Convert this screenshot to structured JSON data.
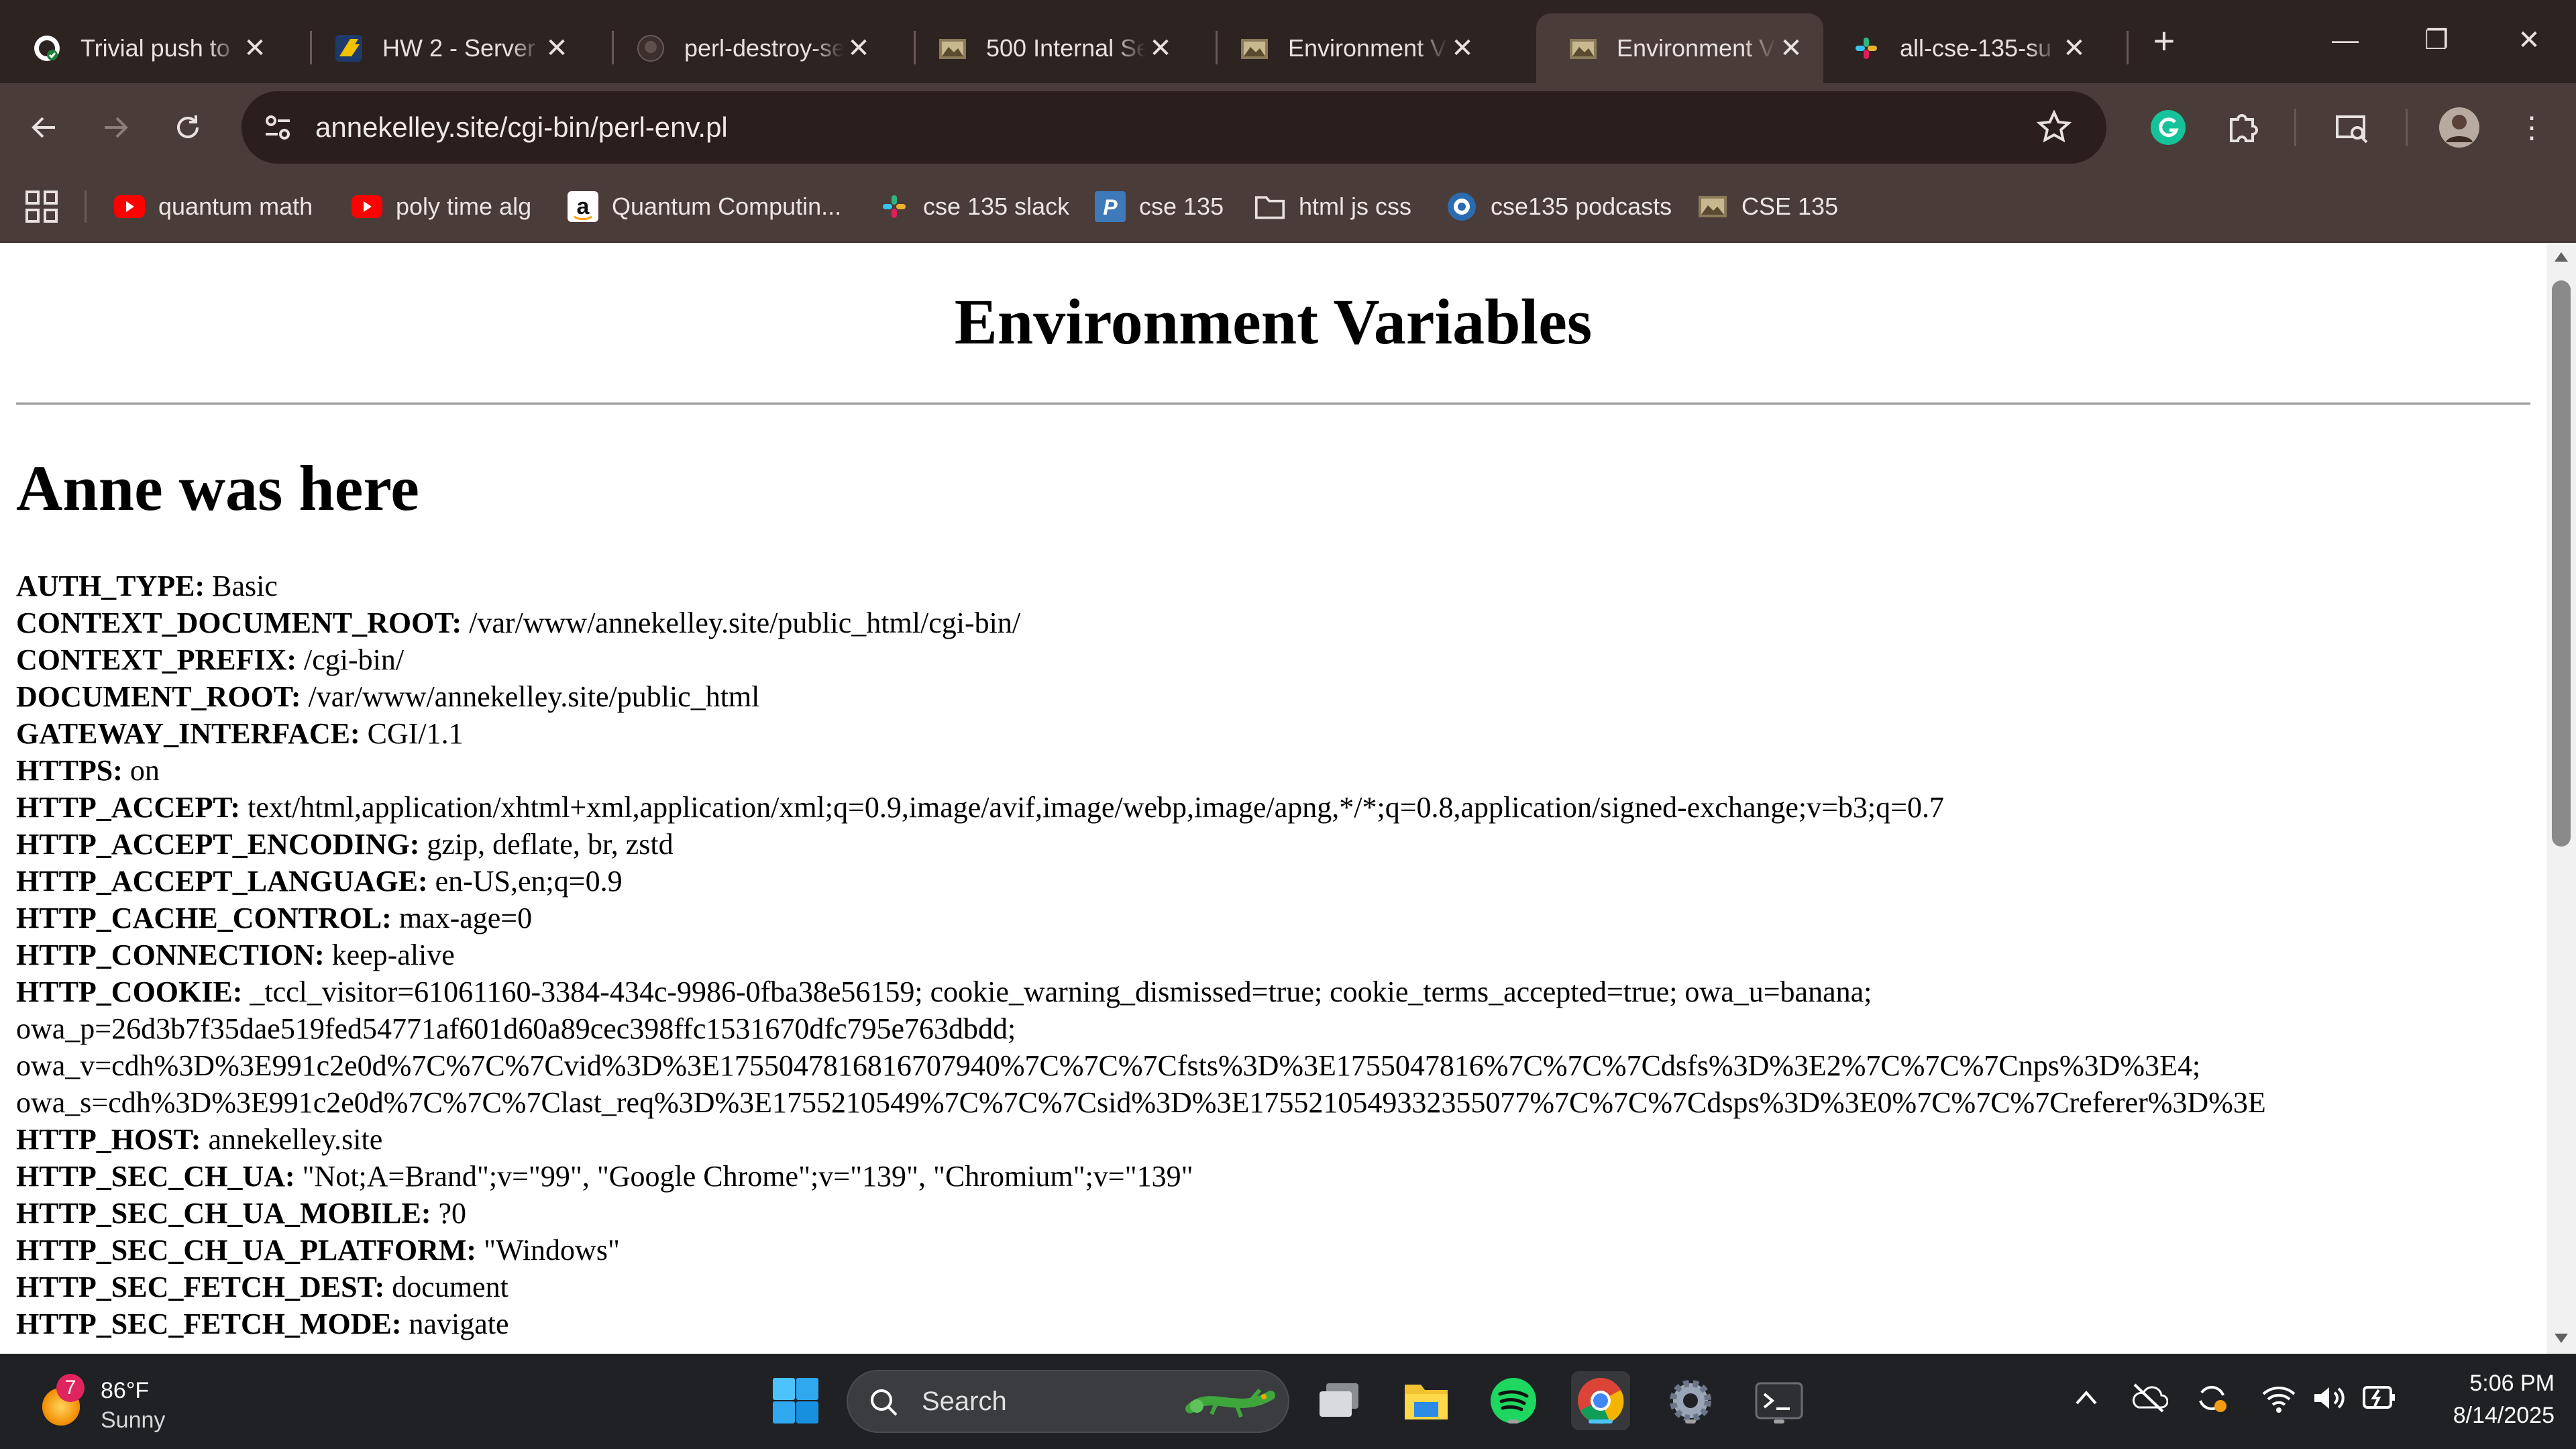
{
  "tabs": [
    {
      "title": "Trivial push to",
      "icon": "github-icon"
    },
    {
      "title": "HW 2 - Server",
      "icon": "hw-icon"
    },
    {
      "title": "perl-destroy-se",
      "icon": "github-icon"
    },
    {
      "title": "500 Internal Se",
      "icon": "site-icon"
    },
    {
      "title": "Environment V",
      "icon": "site-icon"
    },
    {
      "title": "Environment V",
      "icon": "site-icon"
    },
    {
      "title": "all-cse-135-su",
      "icon": "slack-icon"
    }
  ],
  "active_tab": 5,
  "window_controls": {
    "new_tab": "+",
    "minimize": "—",
    "restore": "❐",
    "close": "✕"
  },
  "address_bar": {
    "url": "annekelley.site/cgi-bin/perl-env.pl"
  },
  "bookmarks": [
    {
      "label": "quantum math",
      "icon": "youtube-icon"
    },
    {
      "label": "poly time alg",
      "icon": "youtube-icon"
    },
    {
      "label": "Quantum Computin...",
      "icon": "amazon-icon"
    },
    {
      "label": "cse 135 slack",
      "icon": "slack-icon"
    },
    {
      "label": "cse 135",
      "icon": "piazza-icon"
    },
    {
      "label": "html js css",
      "icon": "folder-icon"
    },
    {
      "label": "cse135 podcasts",
      "icon": "podcast-icon"
    },
    {
      "label": "CSE 135",
      "icon": "site-icon"
    }
  ],
  "page": {
    "heading": "Environment Variables",
    "subheading": "Anne was here",
    "variables": [
      {
        "key": "AUTH_TYPE:",
        "value": "Basic"
      },
      {
        "key": "CONTEXT_DOCUMENT_ROOT:",
        "value": "/var/www/annekelley.site/public_html/cgi-bin/"
      },
      {
        "key": "CONTEXT_PREFIX:",
        "value": "/cgi-bin/"
      },
      {
        "key": "DOCUMENT_ROOT:",
        "value": "/var/www/annekelley.site/public_html"
      },
      {
        "key": "GATEWAY_INTERFACE:",
        "value": "CGI/1.1"
      },
      {
        "key": "HTTPS:",
        "value": "on"
      },
      {
        "key": "HTTP_ACCEPT:",
        "value": "text/html,application/xhtml+xml,application/xml;q=0.9,image/avif,image/webp,image/apng,*/*;q=0.8,application/signed-exchange;v=b3;q=0.7"
      },
      {
        "key": "HTTP_ACCEPT_ENCODING:",
        "value": "gzip, deflate, br, zstd"
      },
      {
        "key": "HTTP_ACCEPT_LANGUAGE:",
        "value": "en-US,en;q=0.9"
      },
      {
        "key": "HTTP_CACHE_CONTROL:",
        "value": "max-age=0"
      },
      {
        "key": "HTTP_CONNECTION:",
        "value": "keep-alive"
      },
      {
        "key": "HTTP_COOKIE:",
        "value": "_tccl_visitor=61061160-3384-434c-9986-0fba38e56159; cookie_warning_dismissed=true; cookie_terms_accepted=true; owa_u=banana;"
      },
      {
        "key": "",
        "value": "owa_p=26d3b7f35dae519fed54771af601d60a89cec398ffc1531670dfc795e763dbdd;"
      },
      {
        "key": "",
        "value": "owa_v=cdh%3D%3E991c2e0d%7C%7C%7Cvid%3D%3E1755047816816707940%7C%7C%7Cfsts%3D%3E1755047816%7C%7C%7Cdsfs%3D%3E2%7C%7C%7Cnps%3D%3E4;"
      },
      {
        "key": "",
        "value": "owa_s=cdh%3D%3E991c2e0d%7C%7C%7Clast_req%3D%3E1755210549%7C%7C%7Csid%3D%3E1755210549332355077%7C%7C%7Cdsps%3D%3E0%7C%7C%7Creferer%3D%3E"
      },
      {
        "key": "HTTP_HOST:",
        "value": "annekelley.site"
      },
      {
        "key": "HTTP_SEC_CH_UA:",
        "value": "\"Not;A=Brand\";v=\"99\", \"Google Chrome\";v=\"139\", \"Chromium\";v=\"139\""
      },
      {
        "key": "HTTP_SEC_CH_UA_MOBILE:",
        "value": "?0"
      },
      {
        "key": "HTTP_SEC_CH_UA_PLATFORM:",
        "value": "\"Windows\""
      },
      {
        "key": "HTTP_SEC_FETCH_DEST:",
        "value": "document"
      },
      {
        "key": "HTTP_SEC_FETCH_MODE:",
        "value": "navigate"
      }
    ]
  },
  "taskbar": {
    "weather": {
      "temp": "86°F",
      "condition": "Sunny",
      "badge": "7"
    },
    "search_placeholder": "Search",
    "clock": {
      "time": "5:06 PM",
      "date": "8/14/2025"
    }
  },
  "colors": {
    "titlebar": "#2d2321",
    "toolbar": "#4a3c38",
    "taskbar": "#1f2124",
    "accent": "#4cc2ff"
  }
}
